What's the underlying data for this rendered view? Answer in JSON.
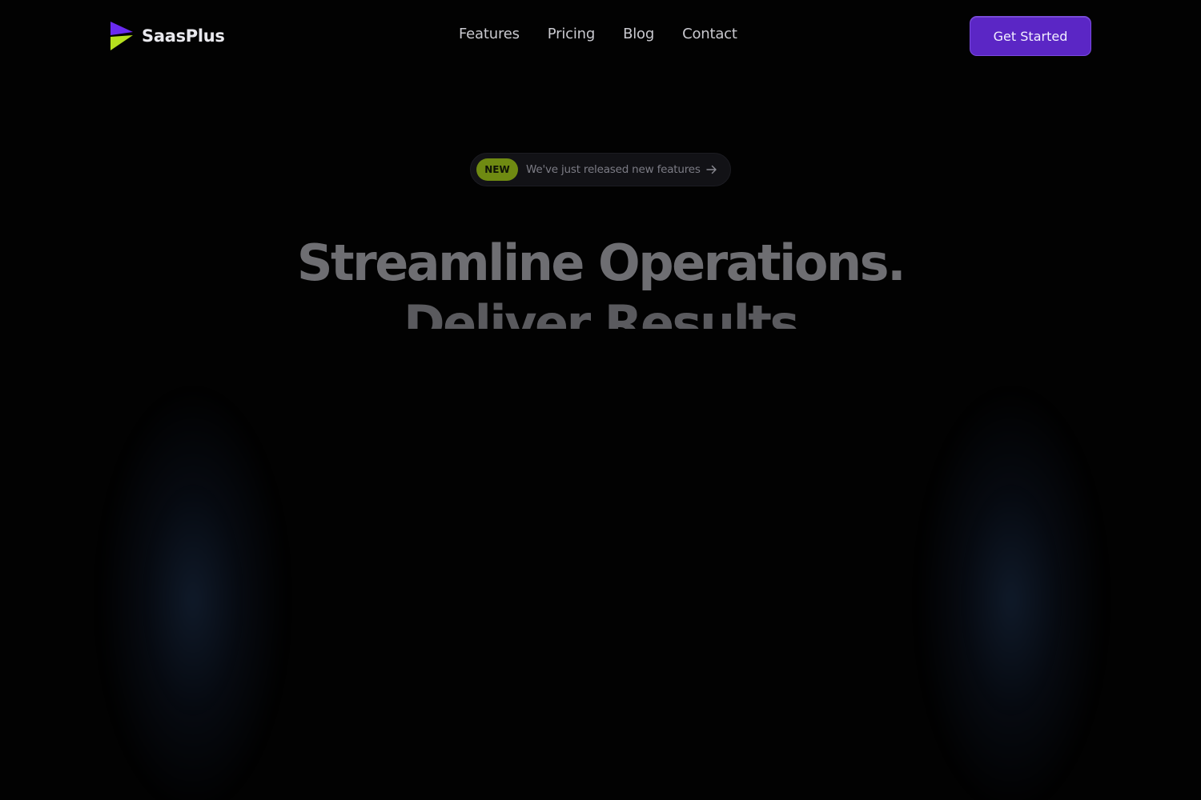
{
  "brand": {
    "name": "SaasPlus",
    "logo_icon": "saasplus-logo-icon",
    "colors": {
      "purple": "#6a2bf0",
      "lime": "#b6e01e"
    }
  },
  "nav": {
    "items": [
      {
        "label": "Features"
      },
      {
        "label": "Pricing"
      },
      {
        "label": "Blog"
      },
      {
        "label": "Contact"
      }
    ]
  },
  "header": {
    "cta_label": "Get Started",
    "cta_color": "#5b26c5"
  },
  "announcement": {
    "badge": "NEW",
    "text": "We've just released new features",
    "icon": "arrow-right-icon",
    "badge_color": "#6f8a12"
  },
  "hero": {
    "line1": "Streamline Operations.",
    "line2": "Deliver Results"
  }
}
